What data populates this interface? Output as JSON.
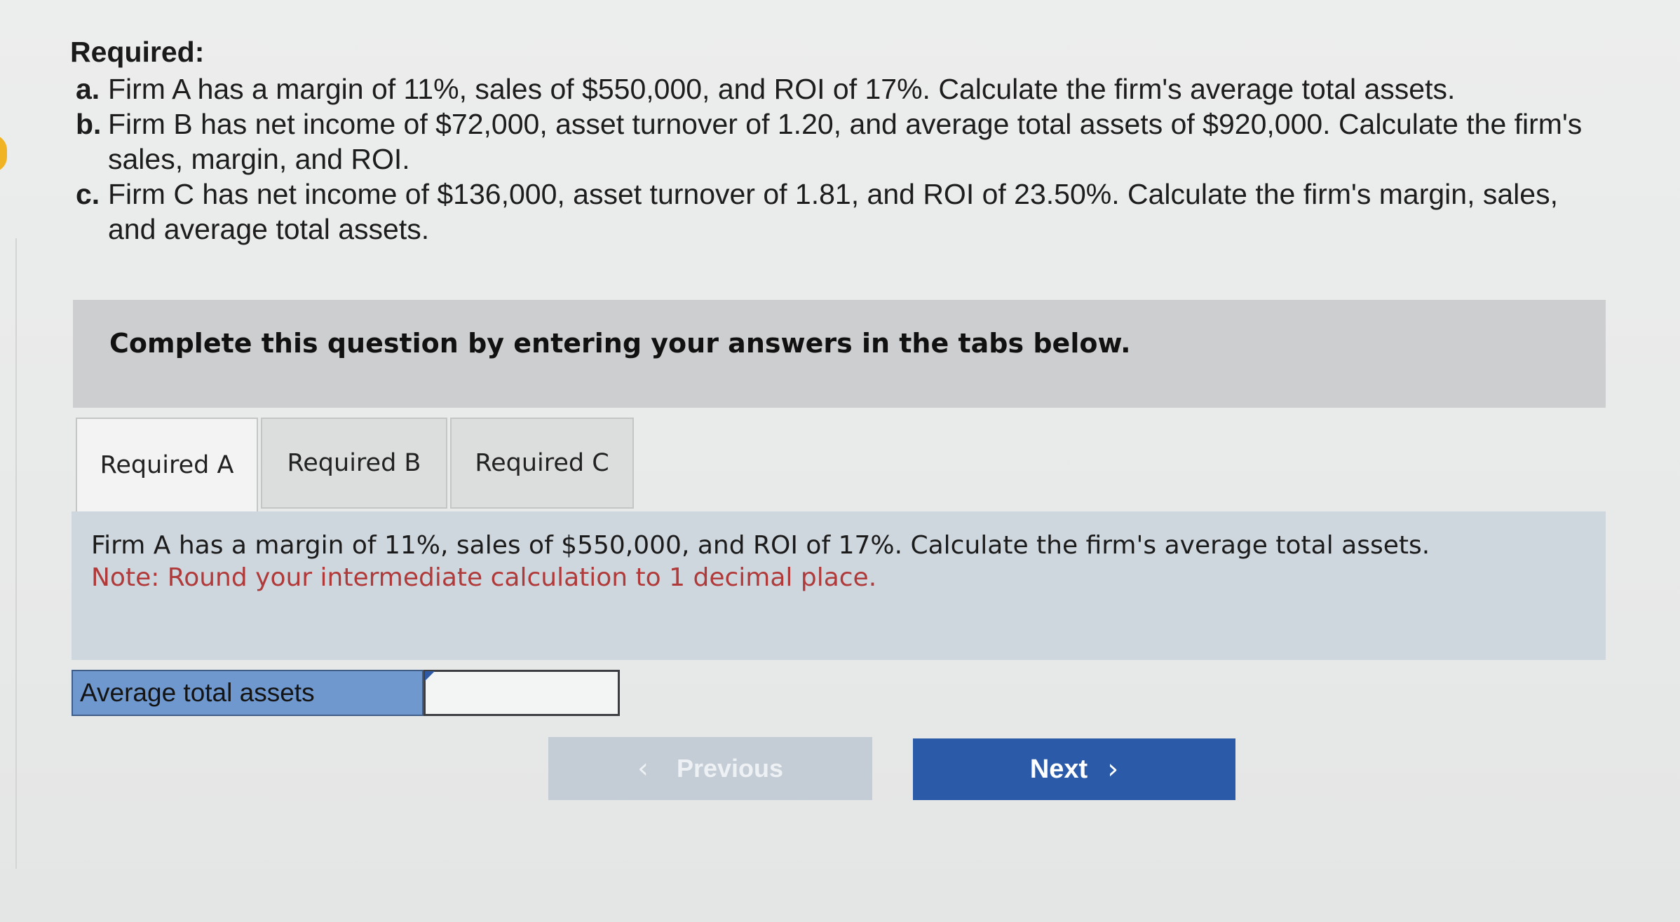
{
  "required": {
    "title": "Required:",
    "items": [
      {
        "letter": "a.",
        "text": "Firm A has a margin of 11%, sales of $550,000, and ROI of 17%. Calculate the firm's average total assets."
      },
      {
        "letter": "b.",
        "text": "Firm B has net income of $72,000, asset turnover of 1.20, and average total assets of $920,000. Calculate the firm's sales, margin, and ROI."
      },
      {
        "letter": "c.",
        "text": "Firm C has net income of $136,000, asset turnover of 1.81, and ROI of 23.50%. Calculate the firm's margin, sales, and average total assets."
      }
    ]
  },
  "banner": {
    "text": "Complete this question by entering your answers in the tabs below."
  },
  "tabs": [
    {
      "label": "Required A",
      "active": true
    },
    {
      "label": "Required B",
      "active": false
    },
    {
      "label": "Required C",
      "active": false
    }
  ],
  "panel": {
    "question": "Firm A has a margin of 11%, sales of $550,000, and ROI of 17%. Calculate the firm's average total assets.",
    "note": "Note: Round your intermediate calculation to 1 decimal place."
  },
  "answer": {
    "label": "Average total assets",
    "value": ""
  },
  "nav": {
    "prev_label": "Previous",
    "next_label": "Next",
    "prev_icon": "chevron-left-icon",
    "next_icon": "chevron-right-icon"
  },
  "colors": {
    "accent": "#2b5aa8",
    "label_bg": "#6f98cf",
    "note_red": "#b03a3a",
    "panel_bg": "#cfd7de",
    "banner_bg": "#cdcecf"
  }
}
